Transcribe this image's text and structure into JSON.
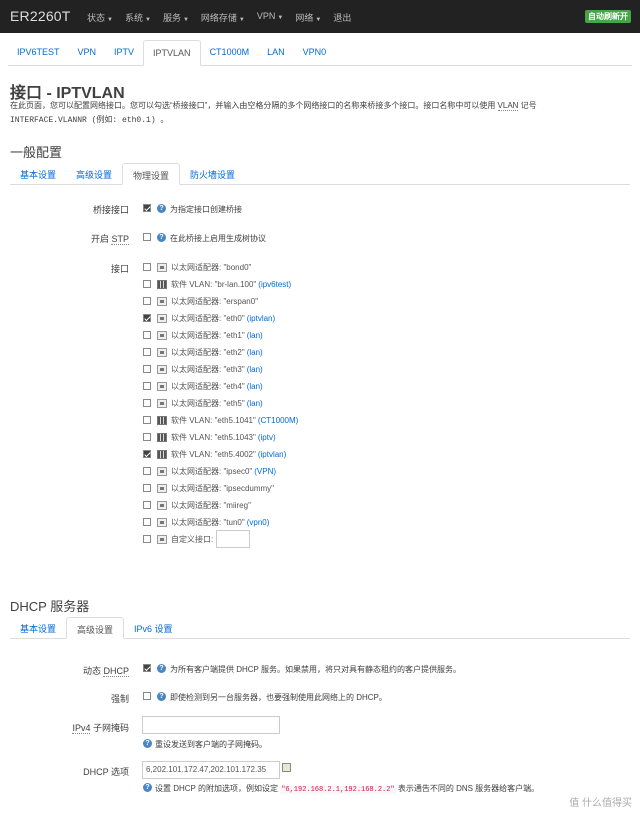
{
  "topbar": {
    "brand": "ER2260T",
    "nav": [
      "状态",
      "系统",
      "服务",
      "网络存储",
      "VPN",
      "网络",
      "退出"
    ],
    "nav_caret": [
      true,
      true,
      true,
      true,
      true,
      true,
      false
    ],
    "autorefresh": "自动刷新开"
  },
  "tabs": [
    "IPV6TEST",
    "VPN",
    "IPTV",
    "IPTVLAN",
    "CT1000M",
    "LAN",
    "VPN0"
  ],
  "active_tab": 3,
  "page": {
    "title": "接口 - IPTVLAN",
    "desc_line1_a": "在此页面，您可以配置网络接口。您可以勾选“桥接接口”，并输入由空格分隔的多个网络接口的名称来桥接多个接口。接口名称中可以使用 ",
    "desc_line1_abbr": "VLAN",
    "desc_line1_b": " 记号",
    "desc_line2": "INTERFACE.VLANNR (例如: eth0.1) 。"
  },
  "general": {
    "heading": "一般配置",
    "subtabs": [
      "基本设置",
      "高级设置",
      "物理设置",
      "防火墙设置"
    ],
    "active_subtab": 2,
    "bridge_label": "桥接接口",
    "bridge_help": "为指定接口创建桥接",
    "stp_label_a": "开启 ",
    "stp_label_abbr": "STP",
    "stp_help": "在此桥接上启用生成树协议",
    "iface_label": "接口",
    "interfaces": [
      {
        "type": "eth",
        "text": "以太网适配器: \"bond0\"",
        "net": "",
        "checked": false
      },
      {
        "type": "vlan",
        "text": "软件 VLAN: \"br-lan.100\"",
        "net": "(ipv6test)",
        "checked": false
      },
      {
        "type": "eth",
        "text": "以太网适配器: \"erspan0\"",
        "net": "",
        "checked": false
      },
      {
        "type": "eth",
        "text": "以太网适配器: \"eth0\"",
        "net": "(iptvlan)",
        "checked": true
      },
      {
        "type": "eth",
        "text": "以太网适配器: \"eth1\"",
        "net": "(lan)",
        "checked": false
      },
      {
        "type": "eth",
        "text": "以太网适配器: \"eth2\"",
        "net": "(lan)",
        "checked": false
      },
      {
        "type": "eth",
        "text": "以太网适配器: \"eth3\"",
        "net": "(lan)",
        "checked": false
      },
      {
        "type": "eth",
        "text": "以太网适配器: \"eth4\"",
        "net": "(lan)",
        "checked": false
      },
      {
        "type": "eth",
        "text": "以太网适配器: \"eth5\"",
        "net": "(lan)",
        "checked": false
      },
      {
        "type": "vlan",
        "text": "软件 VLAN: \"eth5.1041\"",
        "net": "(CT1000M)",
        "checked": false
      },
      {
        "type": "vlan",
        "text": "软件 VLAN: \"eth5.1043\"",
        "net": "(iptv)",
        "checked": false
      },
      {
        "type": "vlan",
        "text": "软件 VLAN: \"eth5.4002\"",
        "net": "(iptvlan)",
        "checked": true
      },
      {
        "type": "eth",
        "text": "以太网适配器: \"ipsec0\"",
        "net": "(VPN)",
        "checked": false
      },
      {
        "type": "eth",
        "text": "以太网适配器: \"ipsecdummy\"",
        "net": "",
        "checked": false
      },
      {
        "type": "eth",
        "text": "以太网适配器: \"miireg\"",
        "net": "",
        "checked": false
      },
      {
        "type": "eth",
        "text": "以太网适配器: \"tun0\"",
        "net": "(vpn0)",
        "checked": false
      }
    ],
    "custom_iface": "自定义接口:"
  },
  "dhcp": {
    "heading": "DHCP 服务器",
    "subtabs": [
      "基本设置",
      "高级设置",
      "IPv6 设置"
    ],
    "active_subtab": 1,
    "dynamic_label_a": "动态 ",
    "dynamic_label_abbr": "DHCP",
    "dynamic_help": "为所有客户端提供 DHCP 服务。如果禁用，将只对具有静态租约的客户提供服务。",
    "force_label": "强制",
    "force_help": "即使检测到另一台服务器，也要强制使用此网络上的 DHCP。",
    "netmask_label_abbr": "IPv4",
    "netmask_label_b": " 子网掩码",
    "netmask_value": "",
    "netmask_help": "重设发送到客户端的子网掩码。",
    "options_label": "DHCP 选项",
    "options_value": "6,202.101.172.47,202.101.172.35",
    "options_help_a": "设置 DHCP 的附加选项，例如设定 ",
    "options_help_code": "\"6,192.168.2.1,192.168.2.2\"",
    "options_help_b": " 表示通告不同的 DNS 服务器给客户端。"
  },
  "watermark": "值 什么值得买"
}
